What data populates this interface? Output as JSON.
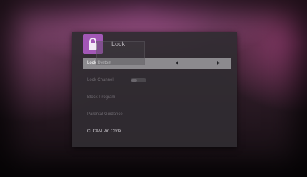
{
  "dialog": {
    "title": "Lock",
    "icon": "padlock-icon",
    "accent_color": "#a257b6"
  },
  "menu": {
    "items": [
      {
        "label": "Lock System",
        "selected": true,
        "enabled": true,
        "control": "selector"
      },
      {
        "label": "Lock Channel",
        "selected": false,
        "enabled": false,
        "control": "toggle"
      },
      {
        "label": "Block Program",
        "selected": false,
        "enabled": false
      },
      {
        "label": "Parental Guidance",
        "selected": false,
        "enabled": false
      },
      {
        "label": "CI CAM Pin Code",
        "selected": false,
        "enabled": true
      }
    ],
    "selector_left_arrow": "◀",
    "selector_right_arrow": "▶"
  }
}
